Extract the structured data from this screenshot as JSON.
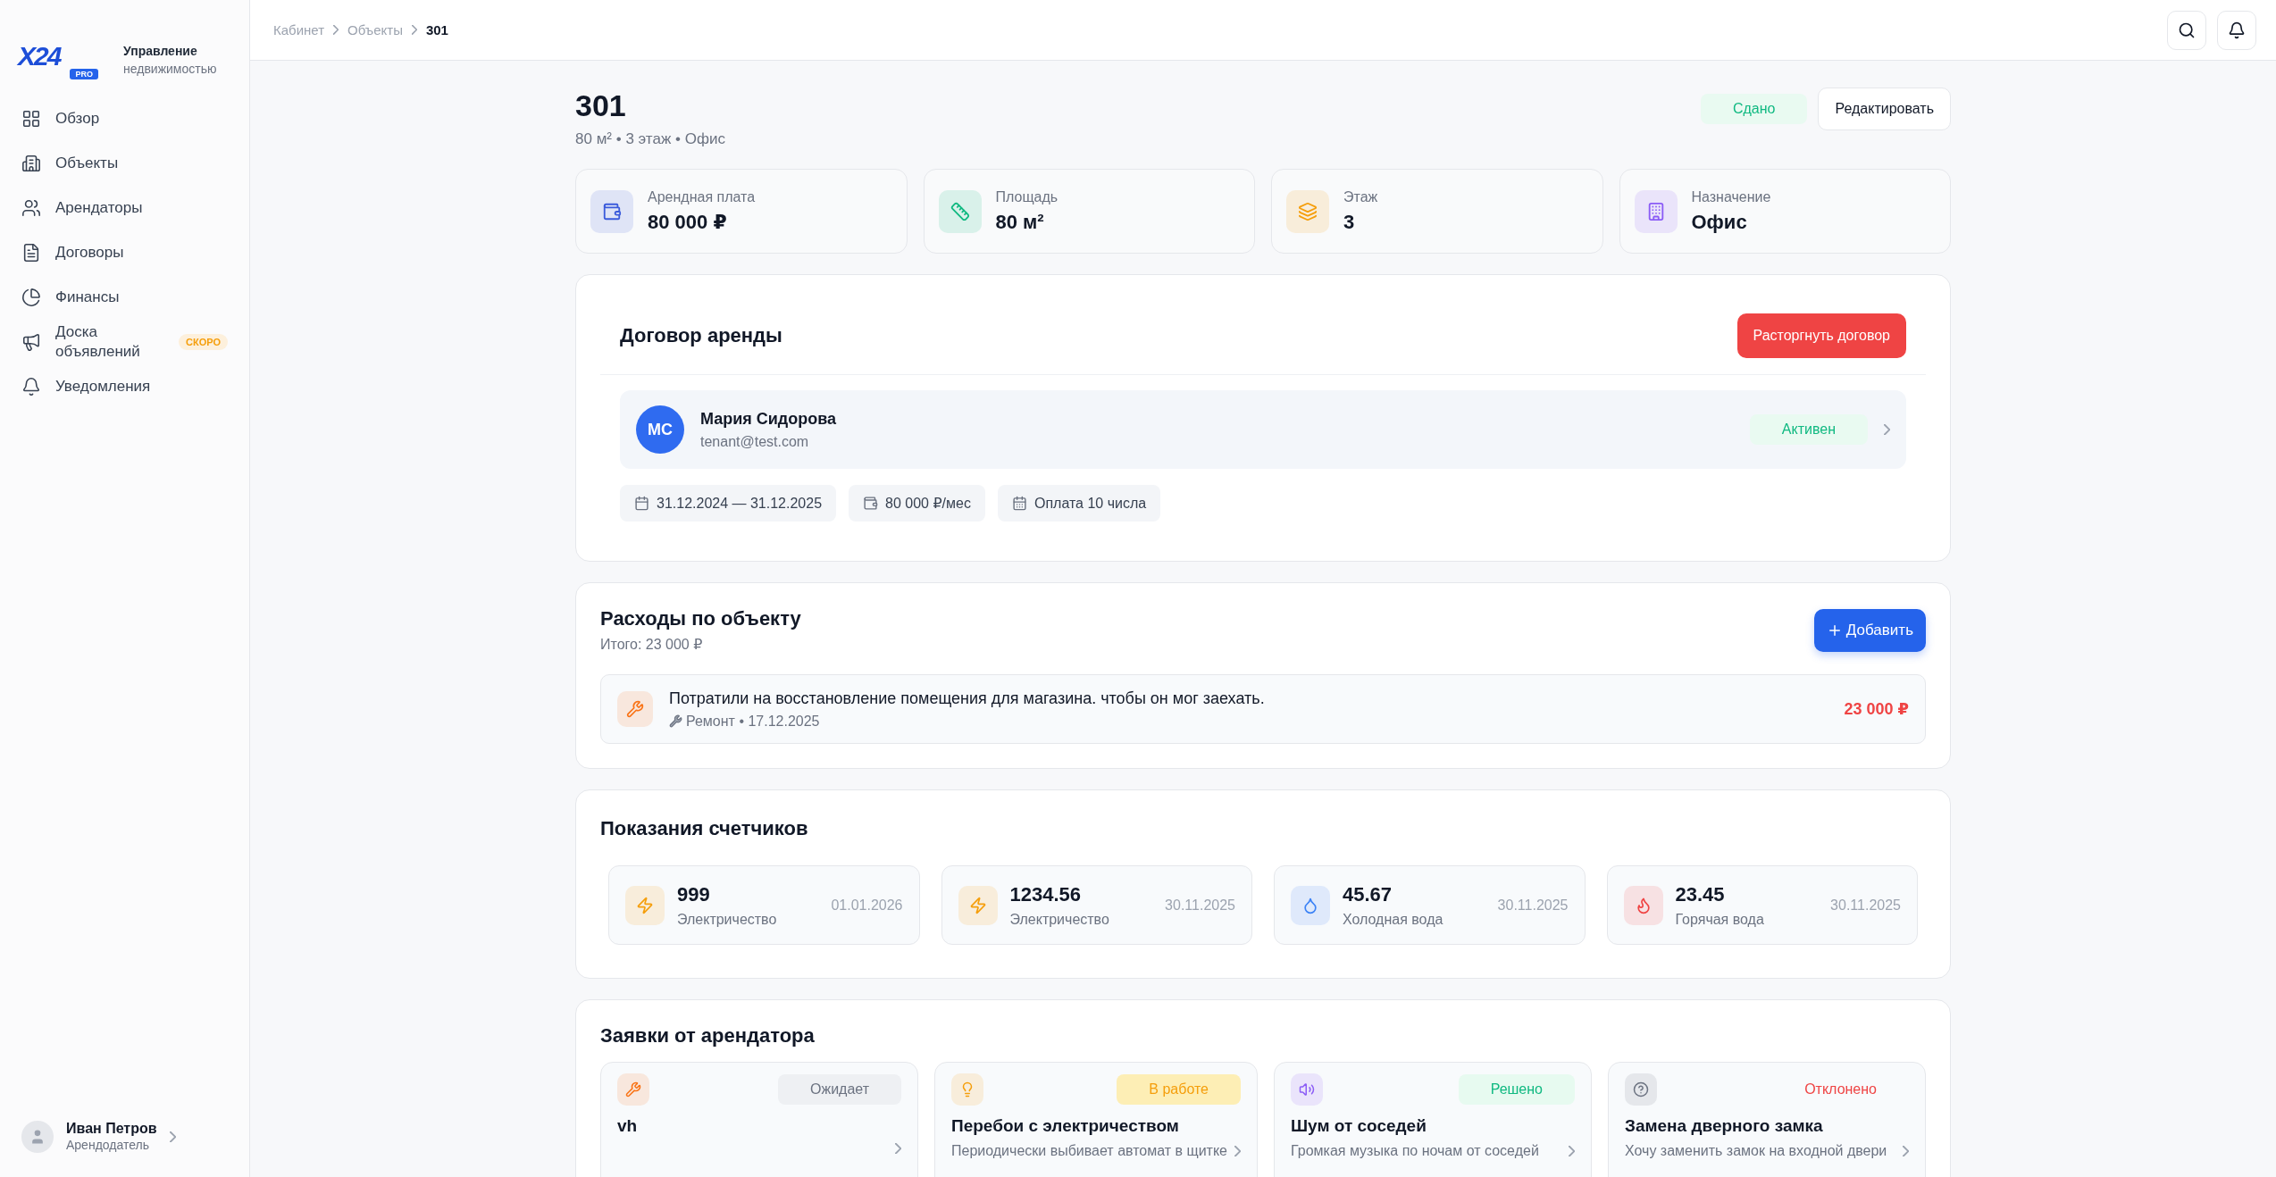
{
  "sidebar": {
    "brand": {
      "logo": "X24",
      "badge": "PRO",
      "title": "Управление",
      "subtitle": "недвижимостью"
    },
    "items": [
      {
        "label": "Обзор",
        "kind": "grid",
        "selected": false
      },
      {
        "label": "Объекты",
        "kind": "building",
        "selected": false
      },
      {
        "label": "Арендаторы",
        "kind": "users",
        "selected": false
      },
      {
        "label": "Договоры",
        "kind": "file",
        "selected": false
      },
      {
        "label": "Финансы",
        "kind": "pie",
        "selected": false
      },
      {
        "label": "Доска объявлений",
        "kind": "megaphone",
        "selected": false,
        "badge": "СКОРО"
      },
      {
        "label": "Уведомления",
        "kind": "bell",
        "selected": false
      }
    ],
    "user": {
      "name": "Иван Петров",
      "role": "Арендодатель"
    }
  },
  "breadcrumbs": [
    {
      "label": "Кабинет",
      "current": false
    },
    {
      "label": "Объекты",
      "current": false
    },
    {
      "label": "301",
      "current": true
    }
  ],
  "header": {
    "title": "301",
    "subtitle": "80 м² • 3 этаж • Офис",
    "status": "Сдано",
    "edit": "Редактировать"
  },
  "stats": [
    {
      "label": "Арендная плата",
      "value": "80 000 ₽",
      "kind": "wallet",
      "color": "#3b5bdb"
    },
    {
      "label": "Площадь",
      "value": "80 м²",
      "kind": "ruler",
      "color": "#10b981"
    },
    {
      "label": "Этаж",
      "value": "3",
      "kind": "layers",
      "color": "#f59e0b"
    },
    {
      "label": "Назначение",
      "value": "Офис",
      "kind": "office",
      "color": "#8b5cf6"
    }
  ],
  "contract": {
    "title": "Договор аренды",
    "terminate": "Расторгнуть договор",
    "tenant": {
      "initials": "МС",
      "name": "Мария Сидорова",
      "email": "tenant@test.com",
      "status": "Активен"
    },
    "chips": [
      {
        "kind": "calendar",
        "text": "31.12.2024 — 31.12.2025"
      },
      {
        "kind": "wallet",
        "text": "80 000 ₽/мес"
      },
      {
        "kind": "calendar-days",
        "text": "Оплата 10 числа"
      }
    ]
  },
  "expenses": {
    "title": "Расходы по объекту",
    "total": "Итого: 23 000 ₽",
    "add": "Добавить",
    "items": [
      {
        "title": "Потратили на восстановление помещения для магазина. чтобы он мог заехать.",
        "meta": "Ремонт • 17.12.2025",
        "amount": "23 000 ₽"
      }
    ]
  },
  "meters": {
    "title": "Показания счетчиков",
    "items": [
      {
        "value": "999",
        "label": "Электричество",
        "date": "01.01.2026",
        "kind": "electricity"
      },
      {
        "value": "1234.56",
        "label": "Электричество",
        "date": "30.11.2025",
        "kind": "electricity"
      },
      {
        "value": "45.67",
        "label": "Холодная вода",
        "date": "30.11.2025",
        "kind": "cold_water"
      },
      {
        "value": "23.45",
        "label": "Горячая вода",
        "date": "30.11.2025",
        "kind": "hot_water"
      }
    ]
  },
  "requests": {
    "title": "Заявки от арендатора",
    "items": [
      {
        "title": "vh",
        "status": "Ожидает",
        "kind": "pending"
      },
      {
        "title": "Перебои с электричеством",
        "status": "В работе",
        "kind": "in_progress",
        "description": "Периодически выбивает автомат в щитке"
      },
      {
        "title": "Шум от соседей",
        "status": "Решено",
        "kind": "resolved",
        "description": "Громкая музыка по ночам от соседей"
      },
      {
        "title": "Замена дверного замка",
        "status": "Отклонено",
        "kind": "rejected",
        "description": "Хочу заменить замок на входной двери"
      }
    ]
  }
}
